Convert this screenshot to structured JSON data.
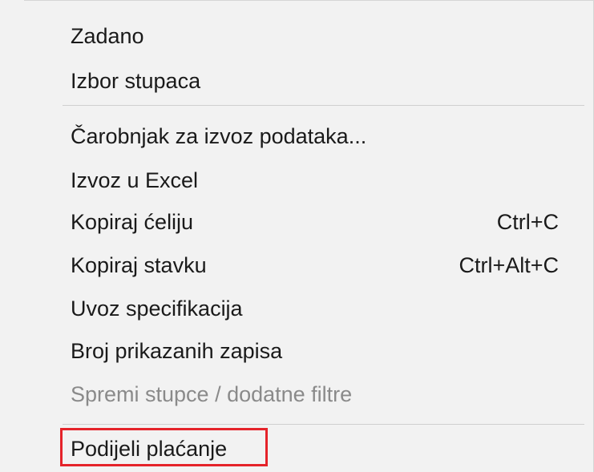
{
  "menu": {
    "groups": [
      {
        "items": [
          {
            "label": "Zadano"
          },
          {
            "label": "Izbor stupaca"
          }
        ]
      },
      {
        "items": [
          {
            "label": "Čarobnjak za izvoz podataka..."
          },
          {
            "label": "Izvoz u Excel"
          },
          {
            "label": "Kopiraj ćeliju",
            "shortcut": "Ctrl+C"
          },
          {
            "label": "Kopiraj stavku",
            "shortcut": "Ctrl+Alt+C"
          },
          {
            "label": "Uvoz specifikacija"
          },
          {
            "label": "Broj prikazanih zapisa"
          },
          {
            "label": "Spremi stupce / dodatne filtre",
            "disabled": true
          }
        ]
      },
      {
        "items": [
          {
            "label": "Podijeli plaćanje",
            "highlighted": true
          }
        ]
      }
    ],
    "highlight_color": "#e5232a",
    "disabled_text_color": "#8a8a8a"
  }
}
